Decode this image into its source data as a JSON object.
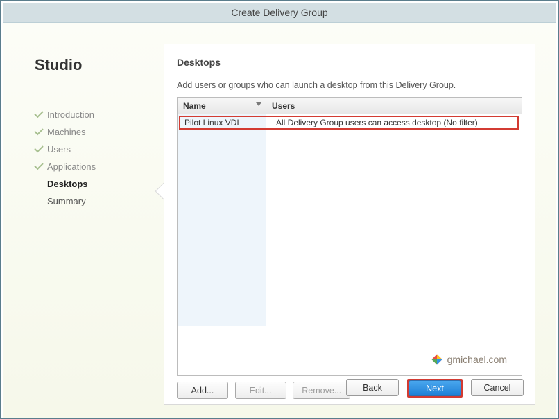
{
  "window": {
    "title": "Create Delivery Group"
  },
  "sidebar": {
    "title": "Studio",
    "steps": [
      {
        "label": "Introduction",
        "state": "done"
      },
      {
        "label": "Machines",
        "state": "done"
      },
      {
        "label": "Users",
        "state": "done"
      },
      {
        "label": "Applications",
        "state": "done"
      },
      {
        "label": "Desktops",
        "state": "current"
      },
      {
        "label": "Summary",
        "state": "future"
      }
    ]
  },
  "main": {
    "heading": "Desktops",
    "description": "Add users or groups who can launch a desktop from this Delivery Group.",
    "table": {
      "columns": [
        "Name",
        "Users"
      ],
      "sort_column": "Name",
      "sort_direction": "descending",
      "rows": [
        {
          "name": "Pilot Linux VDI",
          "users": "All Delivery Group users can access desktop (No filter)"
        }
      ]
    },
    "buttons": {
      "add": "Add...",
      "edit": "Edit...",
      "remove": "Remove..."
    }
  },
  "wizard": {
    "back": "Back",
    "next": "Next",
    "cancel": "Cancel"
  },
  "watermark": {
    "text": "gmichael.com"
  },
  "highlight": {
    "color": "#d33b32",
    "elements": [
      "table-row",
      "next-button"
    ]
  }
}
